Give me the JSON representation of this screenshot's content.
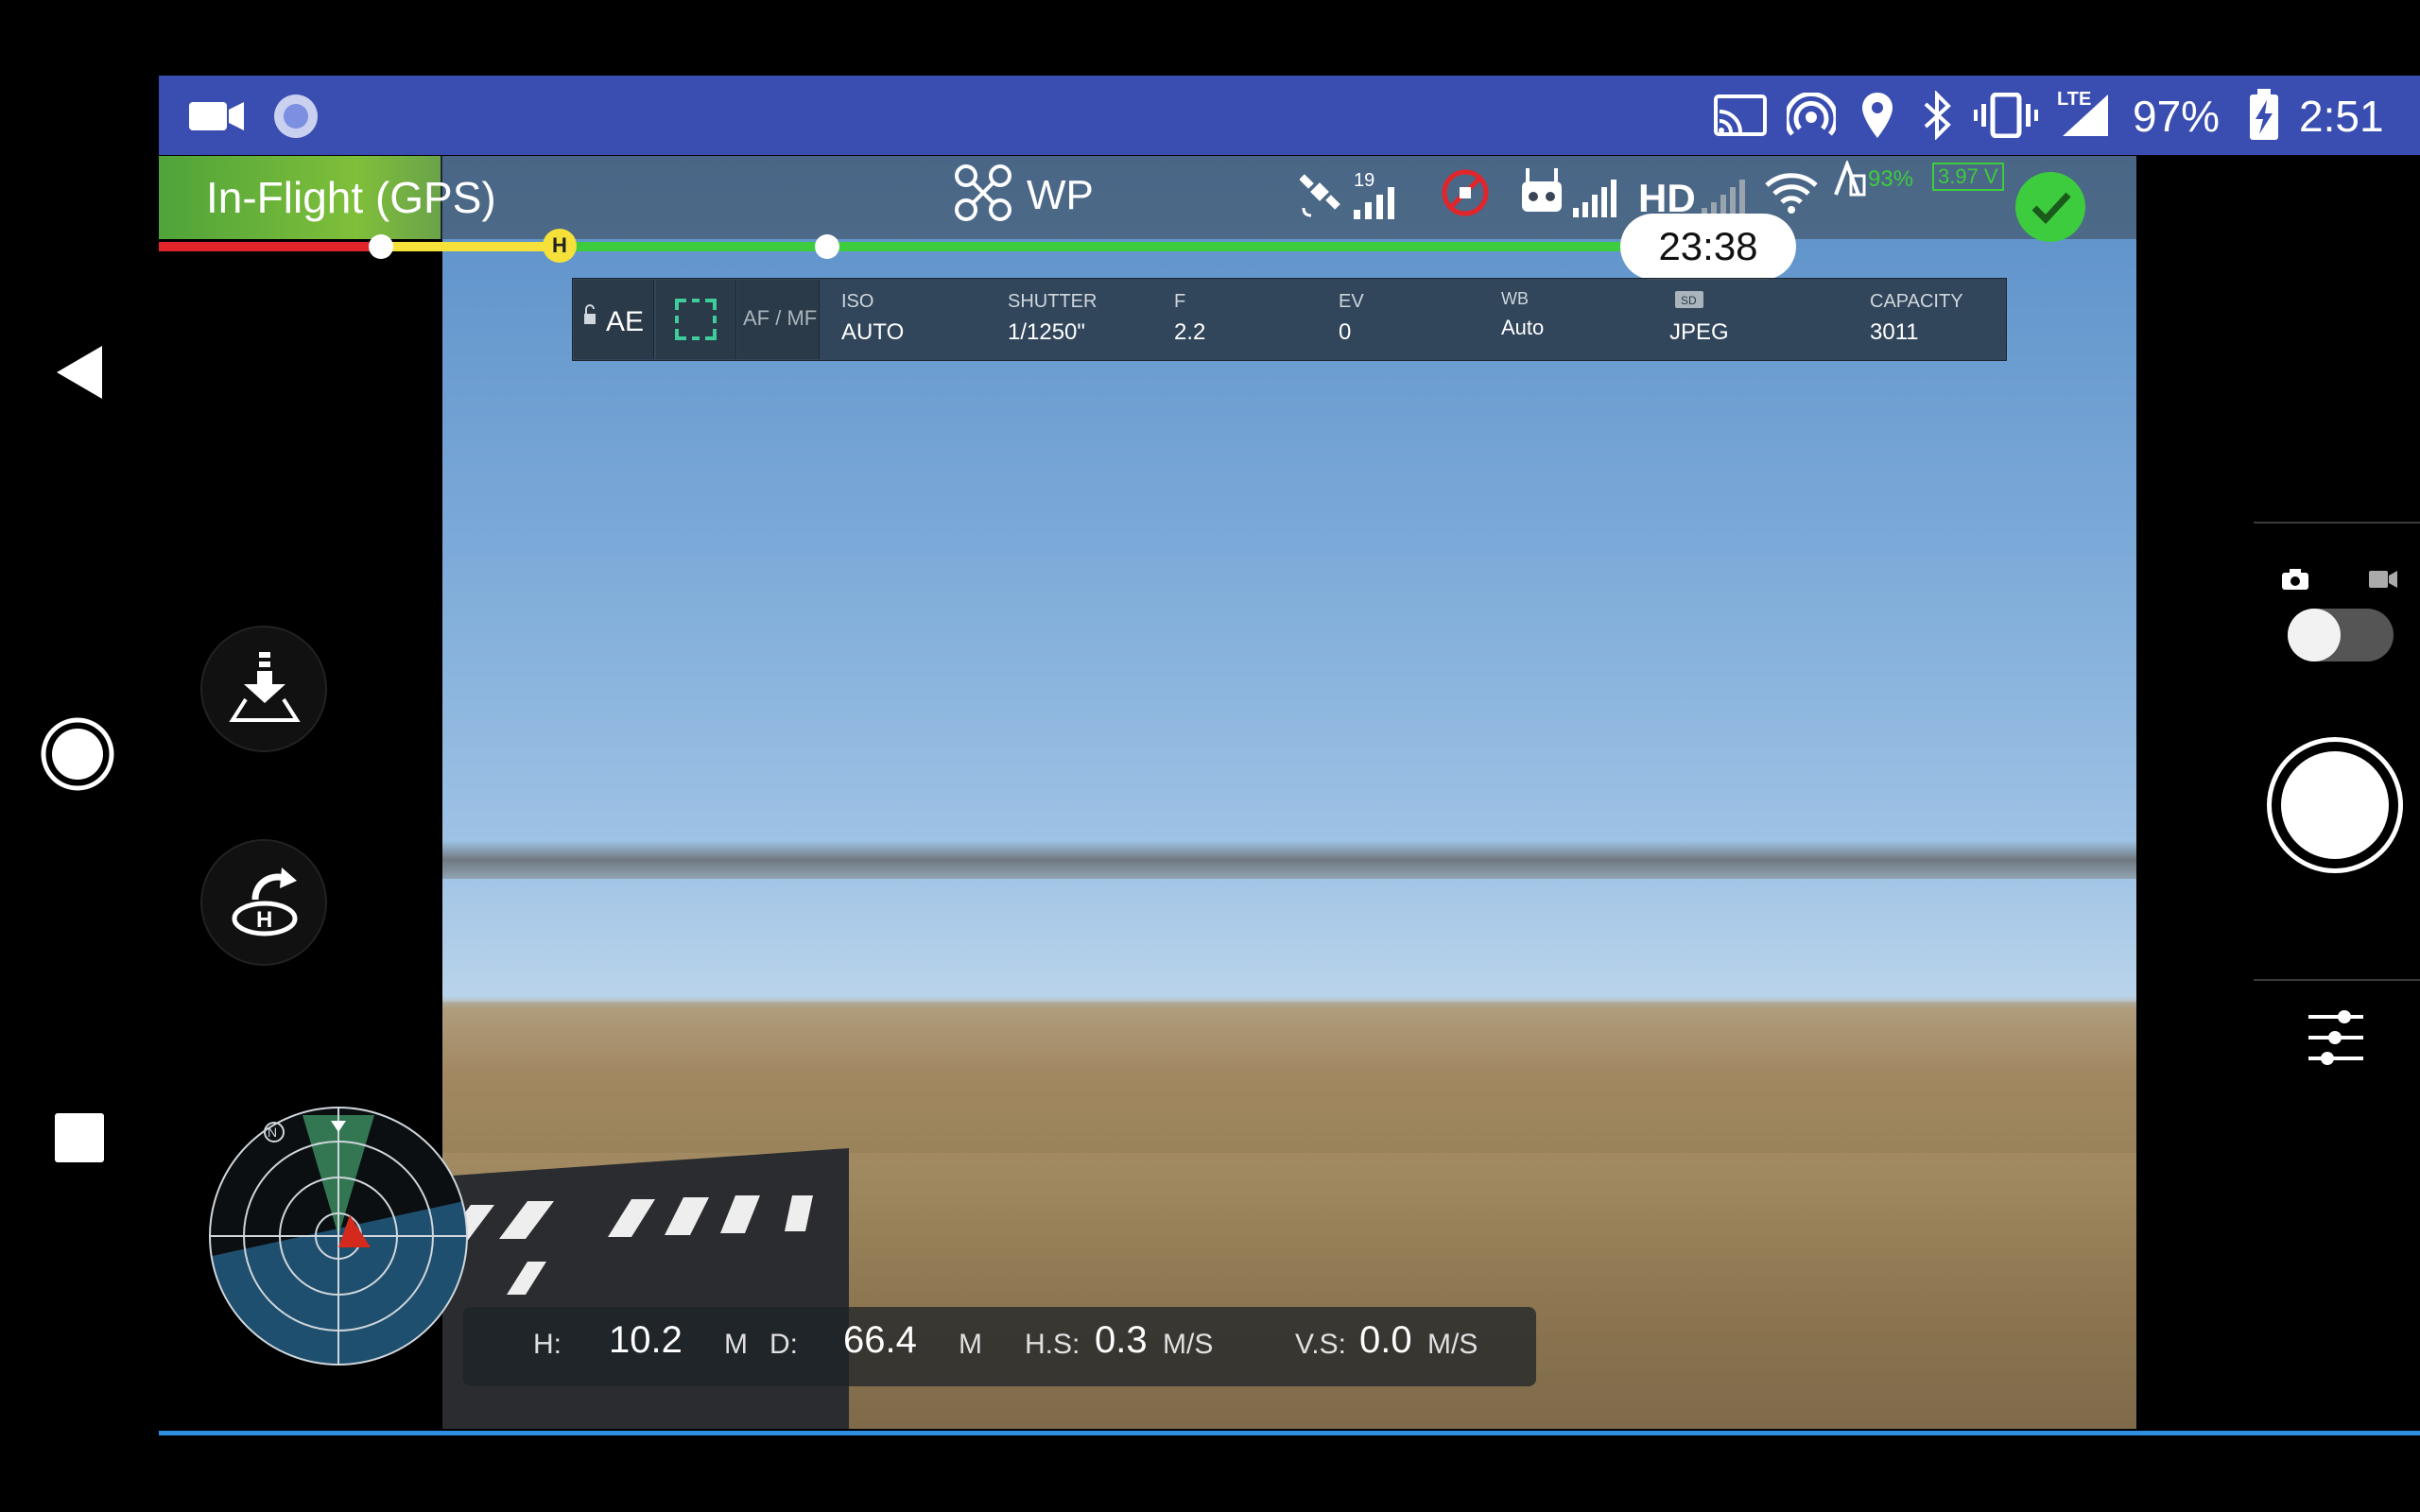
{
  "status_bar": {
    "battery_percent": "97%",
    "time": "2:51",
    "lte_label": "LTE"
  },
  "top_bar": {
    "flight_mode": "In-Flight (GPS)",
    "mission_mode": "WP",
    "satellites": "19",
    "hd_label": "HD",
    "battery_percent": "93%",
    "battery_voltage": "3.97 V",
    "flight_time": "23:38",
    "home_marker": "H"
  },
  "camera": {
    "ae_label": "AE",
    "af_mf_label": "AF / MF",
    "params": [
      {
        "label": "ISO",
        "value": "AUTO"
      },
      {
        "label": "SHUTTER",
        "value": "1/1250\""
      },
      {
        "label": "F",
        "value": "2.2"
      },
      {
        "label": "EV",
        "value": "0"
      },
      {
        "label": "WB",
        "value": "Auto"
      },
      {
        "label": "",
        "value": "JPEG"
      },
      {
        "label": "CAPACITY",
        "value": "3011"
      }
    ]
  },
  "telemetry": {
    "h_label": "H:",
    "h_value": "10.2",
    "h_unit": "M",
    "d_label": "D:",
    "d_value": "66.4",
    "d_unit": "M",
    "hs_label": "H.S:",
    "hs_value": "0.3",
    "hs_unit": "M/S",
    "vs_label": "V.S:",
    "vs_value": "0.0",
    "vs_unit": "M/S"
  },
  "radar": {
    "north_label": "N"
  },
  "colors": {
    "accent_green": "#3dcc3d",
    "status_bar": "#3a4db0",
    "warning_red": "#e0262a",
    "yellow": "#f5e13a"
  }
}
